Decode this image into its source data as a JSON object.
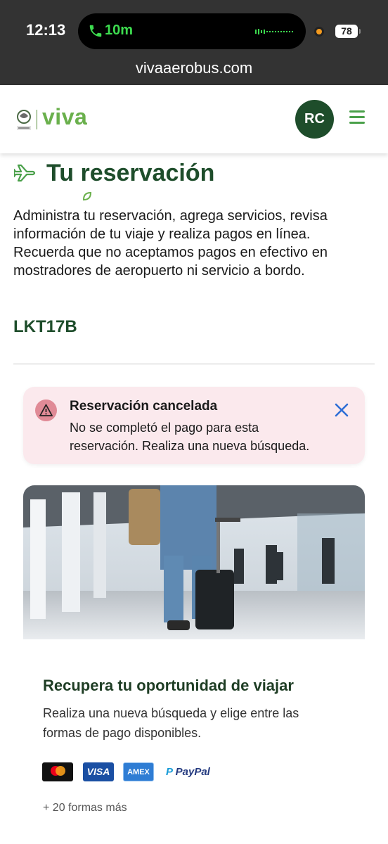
{
  "status_bar": {
    "time": "12:13",
    "call_duration": "10m",
    "battery": "78"
  },
  "browser": {
    "url": "vivaaerobus.com"
  },
  "header": {
    "logo_text": "viva",
    "avatar_initials": "RC",
    "brand_color": "#1e4d2b",
    "accent_color": "#6ab04c"
  },
  "page": {
    "title": "Tu reservación",
    "description": "Administra tu reservación, agrega servicios, revisa información de tu viaje y realiza pagos en línea. Recuerda que no aceptamos pagos en efectivo en mostradores de aeropuerto ni servicio a bordo.",
    "booking_code": "LKT17B"
  },
  "alert": {
    "title": "Reservación cancelada",
    "message": "No se completó el pago para esta reservación. Realiza una nueva búsqueda.",
    "background_color": "#fbe9ed"
  },
  "promo": {
    "title": "Recupera tu oportunidad de viajar",
    "text": "Realiza una nueva búsqueda y elige entre las formas de pago disponibles.",
    "payment_methods": [
      "mastercard",
      "VISA",
      "AMEX",
      "PayPal"
    ],
    "more_methods": "+ 20 formas más"
  }
}
